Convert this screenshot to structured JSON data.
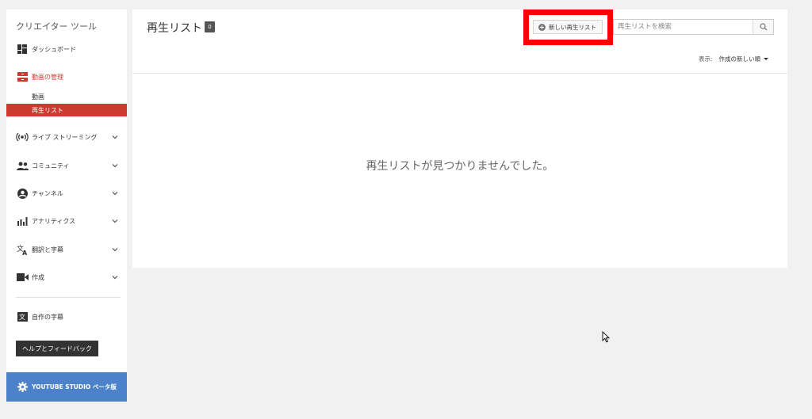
{
  "sidebar": {
    "title": "クリエイター ツール",
    "dashboard": "ダッシュボード",
    "video_manager": "動画の管理",
    "sub_videos": "動画",
    "sub_playlists": "再生リスト",
    "live": "ライブ ストリーミング",
    "community": "コミュニティ",
    "channel": "チャンネル",
    "analytics": "アナリティクス",
    "translations": "翻訳と字幕",
    "create": "作成",
    "your_subtitles": "自作の字幕",
    "help_button": "ヘルプとフィードバック",
    "studio_beta": "YOUTUBE STUDIO ベータ版"
  },
  "header": {
    "title": "再生リスト",
    "count": "0",
    "new_playlist_label": "新しい再生リスト",
    "search_placeholder": "再生リストを検索",
    "sort_prefix": "表示:",
    "sort_value": "作成の新しい順"
  },
  "main": {
    "empty_message": "再生リストが見つかりませんでした。"
  },
  "colors": {
    "accent_red": "#cc3b2f",
    "highlight_red": "#ff0000",
    "studio_blue": "#4b82c9"
  }
}
